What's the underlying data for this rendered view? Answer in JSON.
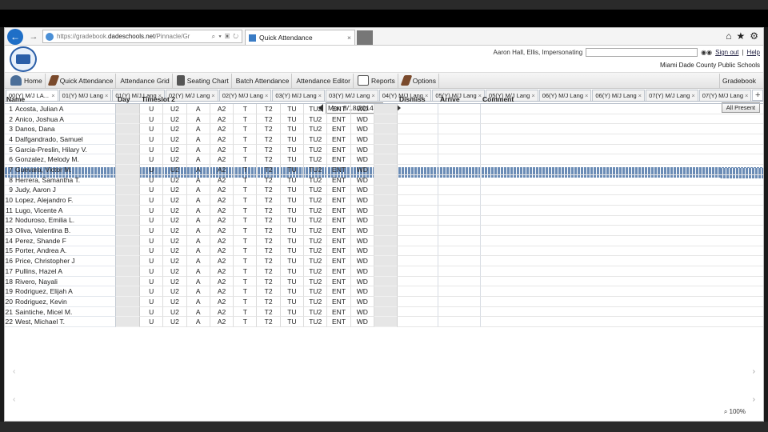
{
  "browser": {
    "url_prefix": "https://gradebook.",
    "url_host": "dadeschools.net",
    "url_rest": "/Pinnacle/Gr",
    "addr_icons": "⌕ ▾ ▣ ↻",
    "tab_title": "Quick Attendance",
    "tab_close": "×"
  },
  "header": {
    "account_text": "Aaron Hall, Ellis, Impersonating",
    "impersonate_placeholder": "",
    "sign_out": "Sign out",
    "help": "Help",
    "district": "Miami Dade County Public Schools"
  },
  "toolbar": {
    "items": [
      "Home",
      "Quick Attendance",
      "Attendance Grid",
      "Seating Chart",
      "Batch Attendance",
      "Attendance Editor",
      "Reports",
      "Options"
    ],
    "gradebook": "Gradebook"
  },
  "period_tabs": [
    "00(Y) M/J LA...",
    "01(Y) M/J Lang",
    "01(Y) M/J Lang",
    "02(Y) M/J Lang",
    "02(Y) M/J Lang",
    "03(Y) M/J Lang",
    "03(Y) M/J Lang",
    "04(Y) M/J Lang",
    "05(Y) M/J Lang",
    "05(Y) M/J Lang",
    "06(Y) M/J Lang",
    "06(Y) M/J Lang",
    "07(Y) M/J Lang",
    "07(Y) M/J Lang"
  ],
  "date": "Mon 8/18/2014",
  "all_present": "All Present",
  "columns": {
    "name": "Name",
    "day": "Day",
    "timeslot": "Timeslot 2",
    "dismiss": "Dismiss",
    "arrive": "Arrive",
    "comment": "Comment"
  },
  "codes": [
    "U",
    "U2",
    "A",
    "A2",
    "T",
    "T2",
    "TU",
    "TU2",
    "ENT",
    "WD"
  ],
  "students": [
    {
      "num": "1",
      "name": "Acosta, Julian A"
    },
    {
      "num": "2",
      "name": "Anico, Joshua A"
    },
    {
      "num": "3",
      "name": "Danos, Dana"
    },
    {
      "num": "4",
      "name": "Dalfgandrado, Samuel"
    },
    {
      "num": "5",
      "name": "Garcia-Preslin, Hilary V."
    },
    {
      "num": "6",
      "name": "Gonzalez, Melody M."
    },
    {
      "num": "7",
      "name": "Guevara, Victor M."
    },
    {
      "num": "8",
      "name": "Herrera, Samantha T."
    },
    {
      "num": "9",
      "name": "Judy, Aaron J"
    },
    {
      "num": "10",
      "name": "Lopez, Alejandro F."
    },
    {
      "num": "11",
      "name": "Lugo, Vicente A"
    },
    {
      "num": "12",
      "name": "Noduroso, Emilia L."
    },
    {
      "num": "13",
      "name": "Oliva, Valentina B."
    },
    {
      "num": "14",
      "name": "Perez, Shande F"
    },
    {
      "num": "15",
      "name": "Porter, Andrea A."
    },
    {
      "num": "16",
      "name": "Price, Christopher J"
    },
    {
      "num": "17",
      "name": "Pullins, Hazel A"
    },
    {
      "num": "18",
      "name": "Rivero, Nayali"
    },
    {
      "num": "19",
      "name": "Rodriguez, Elijah A"
    },
    {
      "num": "20",
      "name": "Rodriguez, Kevin"
    },
    {
      "num": "21",
      "name": "Saintiche, Micel M."
    },
    {
      "num": "22",
      "name": "West, Michael T."
    }
  ],
  "status": {
    "zoom": "100%"
  }
}
